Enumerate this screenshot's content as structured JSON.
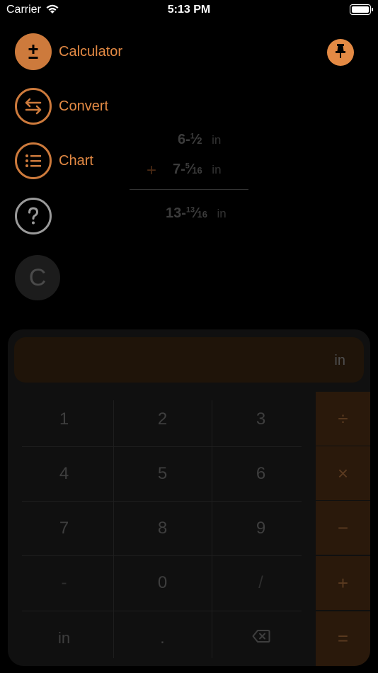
{
  "status_bar": {
    "carrier": "Carrier",
    "time": "5:13 PM"
  },
  "menu": {
    "items": [
      {
        "label": "Calculator",
        "icon": "plus-minus-icon"
      },
      {
        "label": "Convert",
        "icon": "swap-arrows-icon"
      },
      {
        "label": "Chart",
        "icon": "list-icon"
      },
      {
        "label": "",
        "icon": "help-icon"
      }
    ]
  },
  "clear_button": {
    "label": "C"
  },
  "tape": {
    "operand1": {
      "whole": "6-",
      "num": "1",
      "den": "2",
      "unit": "in"
    },
    "operator": "+",
    "operand2": {
      "whole": "7-",
      "num": "5",
      "den": "16",
      "unit": "in"
    },
    "result": {
      "whole": "13-",
      "num": "13",
      "den": "16",
      "unit": "in"
    }
  },
  "display": {
    "value": "",
    "unit": "in"
  },
  "keypad": {
    "rows": [
      [
        "1",
        "2",
        "3"
      ],
      [
        "4",
        "5",
        "6"
      ],
      [
        "7",
        "8",
        "9"
      ],
      [
        "-",
        "0",
        "/"
      ],
      [
        "in",
        ".",
        "backspace"
      ]
    ],
    "operators": [
      "÷",
      "×",
      "−",
      "+",
      "="
    ]
  },
  "colors": {
    "accent": "#e48a44",
    "accent_fill": "#cd7a3c",
    "help_ring": "#9a9a9a"
  }
}
